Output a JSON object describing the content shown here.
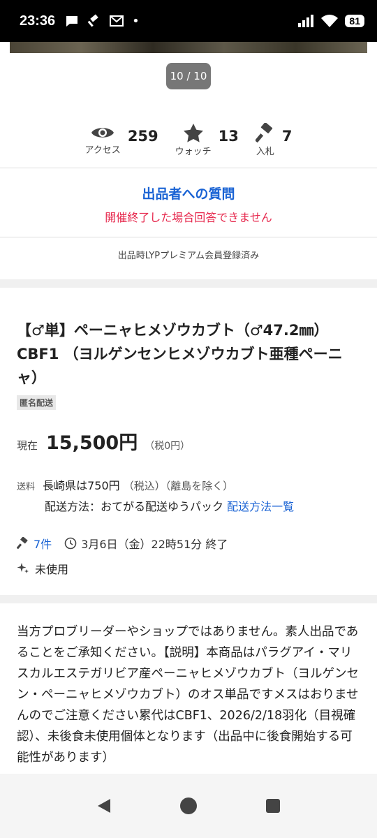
{
  "status": {
    "time": "23:36",
    "battery": "81"
  },
  "gallery": {
    "pager": "10 / 10"
  },
  "stats": [
    {
      "label": "アクセス",
      "value": "259",
      "icon": "eye-icon"
    },
    {
      "label": "ウォッチ",
      "value": "13",
      "icon": "star-icon"
    },
    {
      "label": "入札",
      "value": "7",
      "icon": "gavel-icon"
    }
  ],
  "question": {
    "link": "出品者への質問",
    "warning": "開催終了した場合回答できません"
  },
  "premium_note": "出品時LYPプレミアム会員登録済み",
  "item": {
    "title": "【♂単】ペーニャヒメゾウカブト（♂47.2㎜）CBF1 （ヨルゲンセンヒメゾウカブト亜種ペーニャ）",
    "tag": "匿名配送",
    "price_label": "現在",
    "price": "15,500円",
    "tax": "（税0円）",
    "shipping_label": "送料",
    "shipping_main": "長崎県は750円",
    "shipping_tax": "（税込）（離島を除く）",
    "shipping_method": "配送方法：おてがる配送ゆうパック",
    "shipping_link": "配送方法一覧",
    "bids": "7件",
    "end_time": "3月6日（金）22時51分 終了",
    "condition": "未使用"
  },
  "description": "当方プロブリーダーやショップではありません。素人出品であることをご承知ください。【説明】本商品はパラグアイ・マリスカルエステガリビア産ペーニャヒメゾウカブト（ヨルゲンセン・ペーニャヒメゾウカブト）のオス単品ですメスはおりませんのでご注意ください累代はCBF1、2026/2/18羽化（目視確認）、未後食未使用個体となります（出品中に後食開始する可能性があります）"
}
